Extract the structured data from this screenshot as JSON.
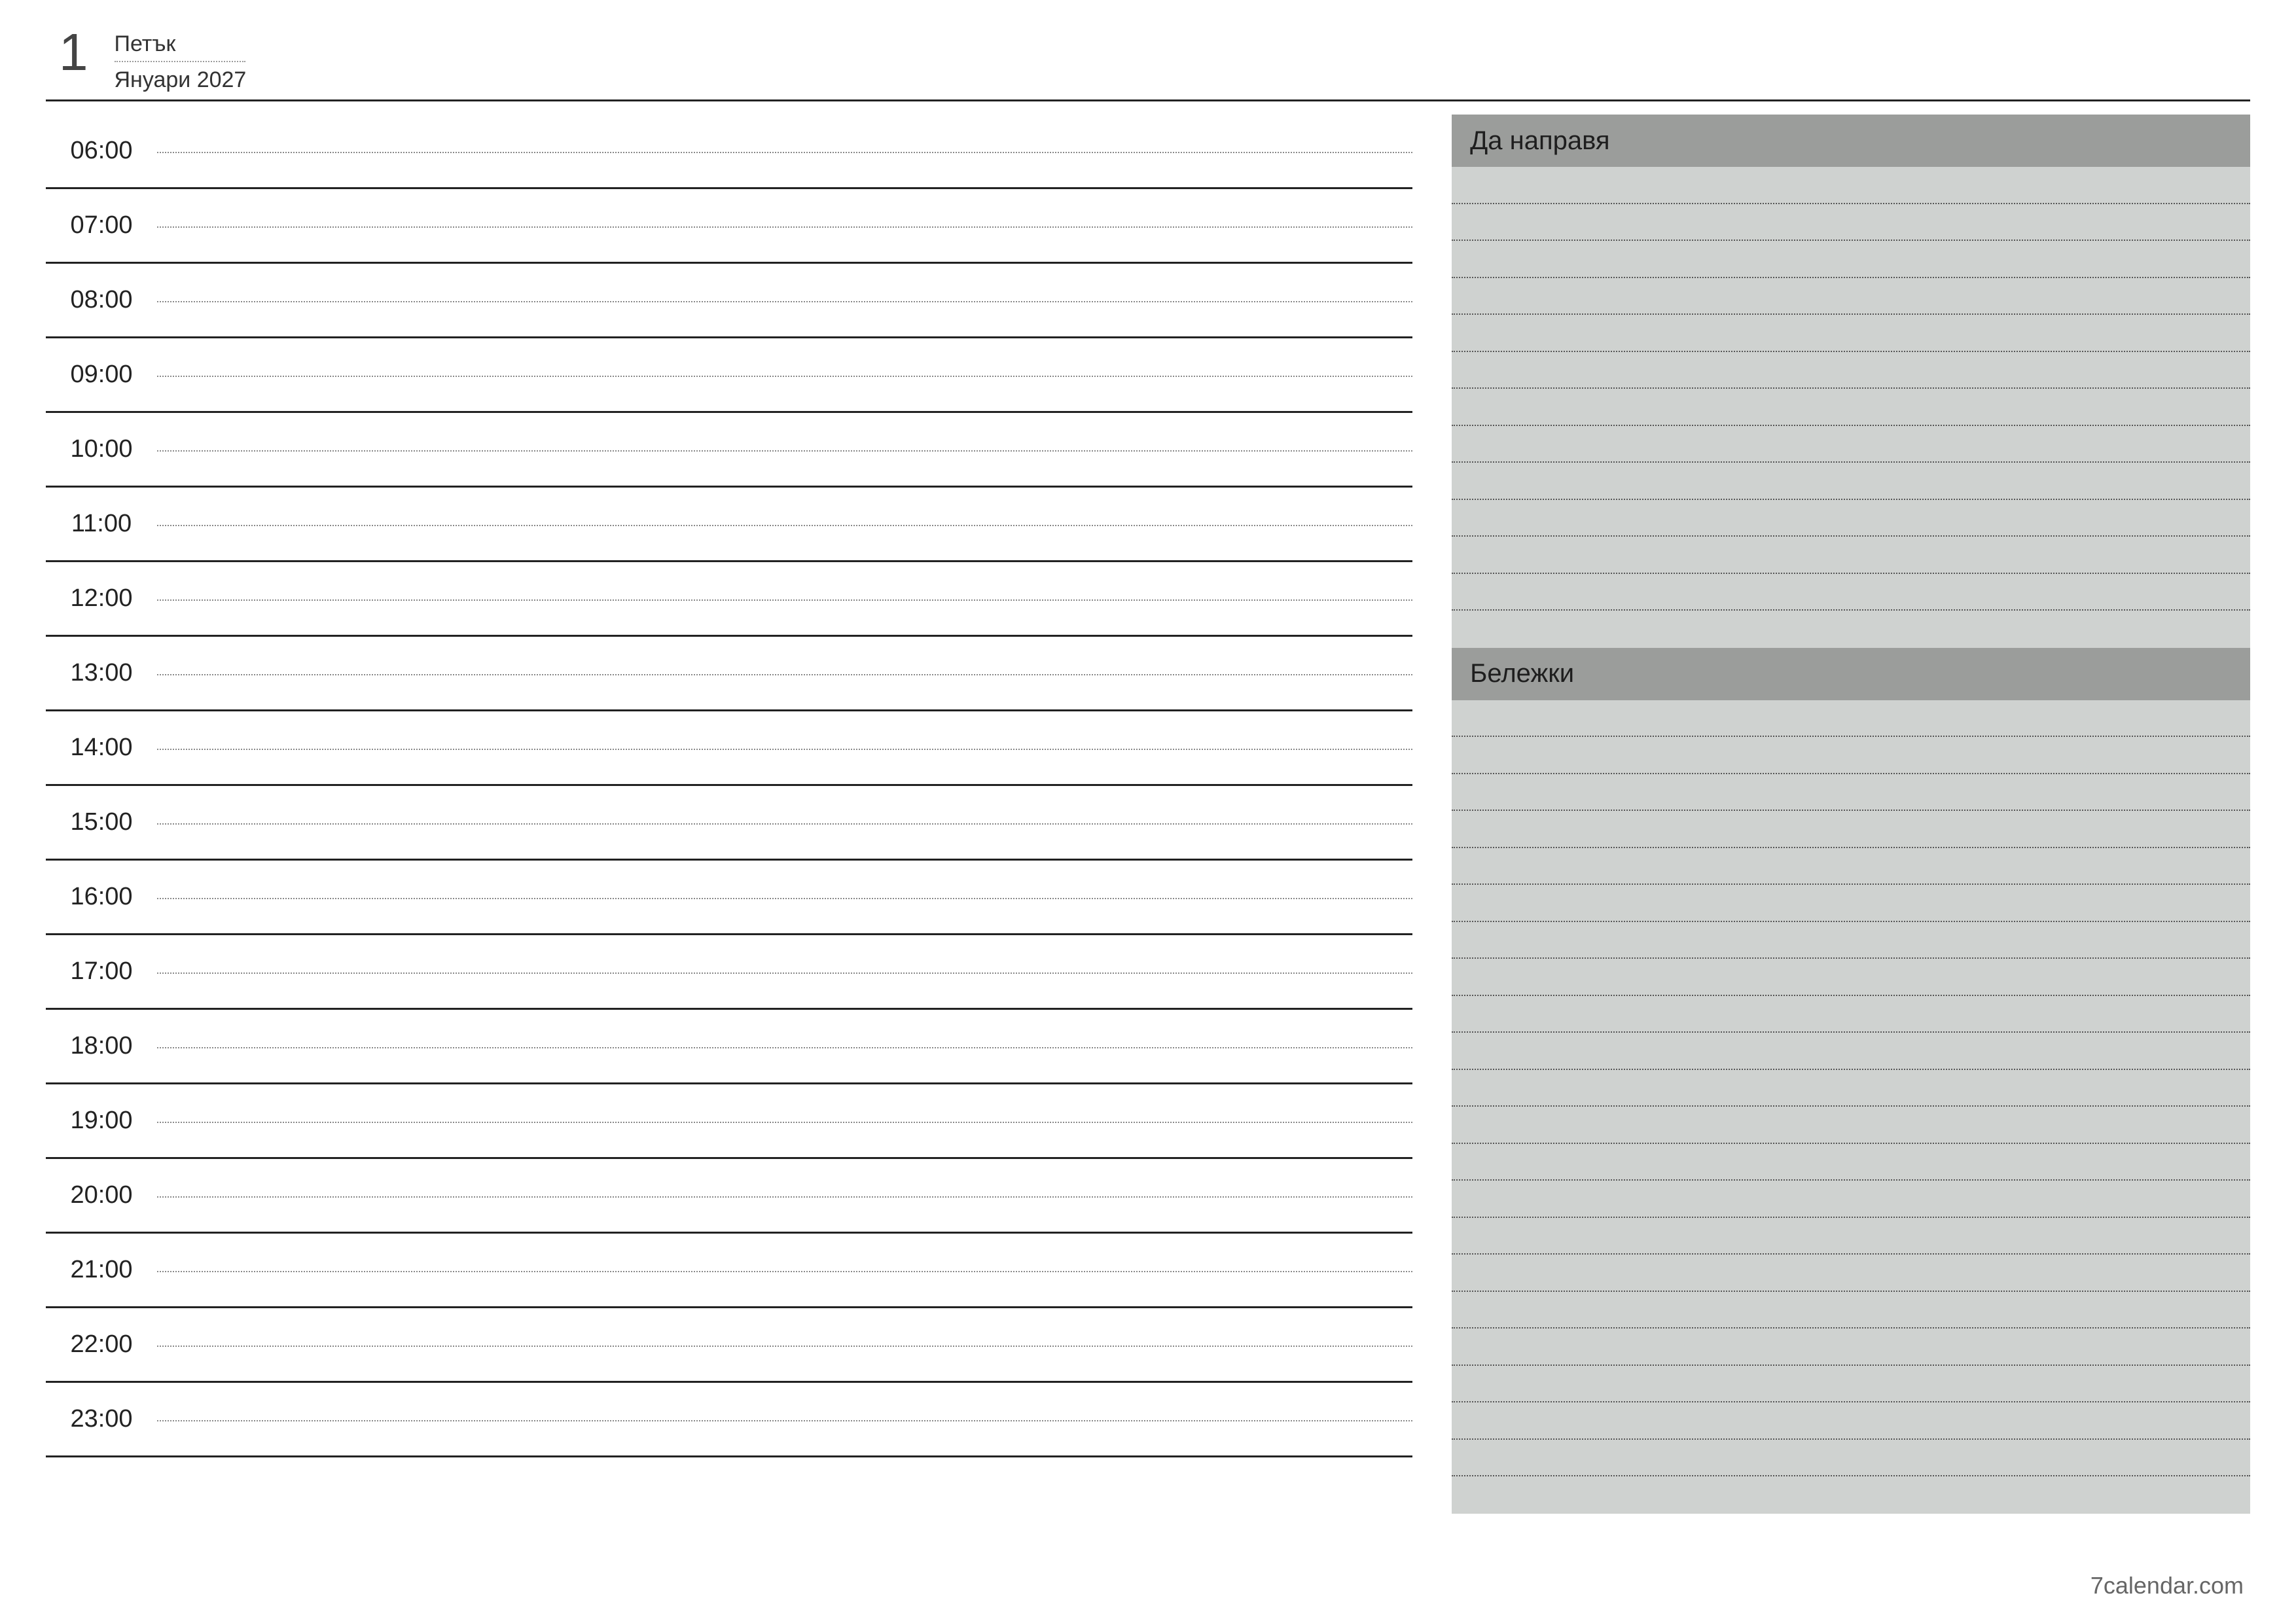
{
  "header": {
    "day_number": "1",
    "weekday": "Петък",
    "month_year": "Януари 2027"
  },
  "schedule": {
    "hours": [
      "06:00",
      "07:00",
      "08:00",
      "09:00",
      "10:00",
      "11:00",
      "12:00",
      "13:00",
      "14:00",
      "15:00",
      "16:00",
      "17:00",
      "18:00",
      "19:00",
      "20:00",
      "21:00",
      "22:00",
      "23:00"
    ]
  },
  "sidebar": {
    "todo_title": "Да направя",
    "notes_title": "Бележки",
    "todo_lines": 13,
    "notes_lines": 22
  },
  "footer": {
    "brand": "7calendar.com"
  }
}
